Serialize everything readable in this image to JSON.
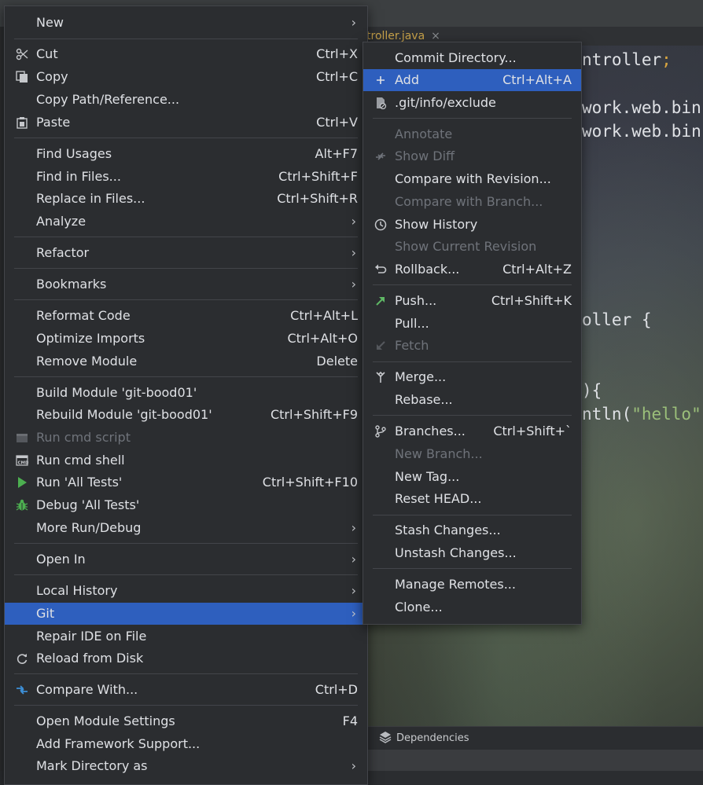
{
  "background": {
    "tab_name": "troller.java",
    "tab_close": "×",
    "code_lines": [
      {
        "text": "ntroller",
        "suffix": ";"
      },
      {
        "text": "work.web.bin"
      },
      {
        "text": "work.web.bin"
      },
      {
        "text": "oller {"
      },
      {
        "text": "){"
      },
      {
        "text": "ntln(",
        "string": "\"hello\""
      }
    ],
    "dependencies_tab": "Dependencies"
  },
  "main_menu": {
    "items": [
      {
        "label": "New",
        "mnemonic": "N"
      },
      {
        "label": "Cut",
        "shortcut": "Ctrl+X"
      },
      {
        "label": "Copy",
        "shortcut": "Ctrl+C"
      },
      {
        "label": "Copy Path/Reference..."
      },
      {
        "label": "Paste",
        "shortcut": "Ctrl+V"
      },
      {
        "label": "Find Usages",
        "shortcut": "Alt+F7"
      },
      {
        "label": "Find in Files...",
        "shortcut": "Ctrl+Shift+F"
      },
      {
        "label": "Replace in Files...",
        "shortcut": "Ctrl+Shift+R"
      },
      {
        "label": "Analyze"
      },
      {
        "label": "Refactor"
      },
      {
        "label": "Bookmarks"
      },
      {
        "label": "Reformat Code",
        "shortcut": "Ctrl+Alt+L"
      },
      {
        "label": "Optimize Imports",
        "shortcut": "Ctrl+Alt+O"
      },
      {
        "label": "Remove Module",
        "shortcut": "Delete"
      },
      {
        "label": "Build Module 'git-bood01'"
      },
      {
        "label": "Rebuild Module 'git-bood01'",
        "shortcut": "Ctrl+Shift+F9"
      },
      {
        "label": "Run cmd script"
      },
      {
        "label": "Run cmd shell"
      },
      {
        "label": "Run 'All Tests'",
        "shortcut": "Ctrl+Shift+F10"
      },
      {
        "label": "Debug 'All Tests'"
      },
      {
        "label": "More Run/Debug"
      },
      {
        "label": "Open In"
      },
      {
        "label": "Local History"
      },
      {
        "label": "Git"
      },
      {
        "label": "Repair IDE on File"
      },
      {
        "label": "Reload from Disk"
      },
      {
        "label": "Compare With...",
        "shortcut": "Ctrl+D"
      },
      {
        "label": "Open Module Settings",
        "shortcut": "F4"
      },
      {
        "label": "Add Framework Support..."
      },
      {
        "label": "Mark Directory as"
      }
    ]
  },
  "git_menu": {
    "items": [
      {
        "label": "Commit Directory..."
      },
      {
        "label": "Add",
        "shortcut": "Ctrl+Alt+A"
      },
      {
        "label": ".git/info/exclude"
      },
      {
        "label": "Annotate"
      },
      {
        "label": "Show Diff"
      },
      {
        "label": "Compare with Revision..."
      },
      {
        "label": "Compare with Branch..."
      },
      {
        "label": "Show History"
      },
      {
        "label": "Show Current Revision"
      },
      {
        "label": "Rollback...",
        "shortcut": "Ctrl+Alt+Z"
      },
      {
        "label": "Push...",
        "shortcut": "Ctrl+Shift+K"
      },
      {
        "label": "Pull..."
      },
      {
        "label": "Fetch"
      },
      {
        "label": "Merge..."
      },
      {
        "label": "Rebase..."
      },
      {
        "label": "Branches...",
        "shortcut": "Ctrl+Shift+`"
      },
      {
        "label": "New Branch..."
      },
      {
        "label": "New Tag..."
      },
      {
        "label": "Reset HEAD..."
      },
      {
        "label": "Stash Changes..."
      },
      {
        "label": "Unstash Changes..."
      },
      {
        "label": "Manage Remotes..."
      },
      {
        "label": "Clone..."
      }
    ]
  },
  "colors": {
    "menu_bg": "#2b2d30",
    "selection": "#2e5fbe",
    "disabled_text": "#6f737a",
    "text": "#dfe1e5",
    "run_icon_green": "#4caf50",
    "push_arrow_green": "#5fb865"
  },
  "icons": {
    "cut": "scissors-icon",
    "copy": "copy-icon",
    "paste": "clipboard-icon",
    "run_cmd_script": "terminal-icon",
    "run_cmd_shell": "cmd-icon",
    "run_tests": "play-icon",
    "debug_tests": "bug-icon",
    "reload": "reload-icon",
    "compare": "compare-icon",
    "add": "plus-icon",
    "exclude": "ignore-file-icon",
    "show_diff": "diff-icon",
    "show_history": "clock-icon",
    "rollback": "undo-icon",
    "push": "push-arrow-icon",
    "fetch": "fetch-arrow-icon",
    "merge": "merge-icon",
    "branches": "branch-icon",
    "dependencies": "layers-icon",
    "submenu": "chevron-right-icon"
  }
}
